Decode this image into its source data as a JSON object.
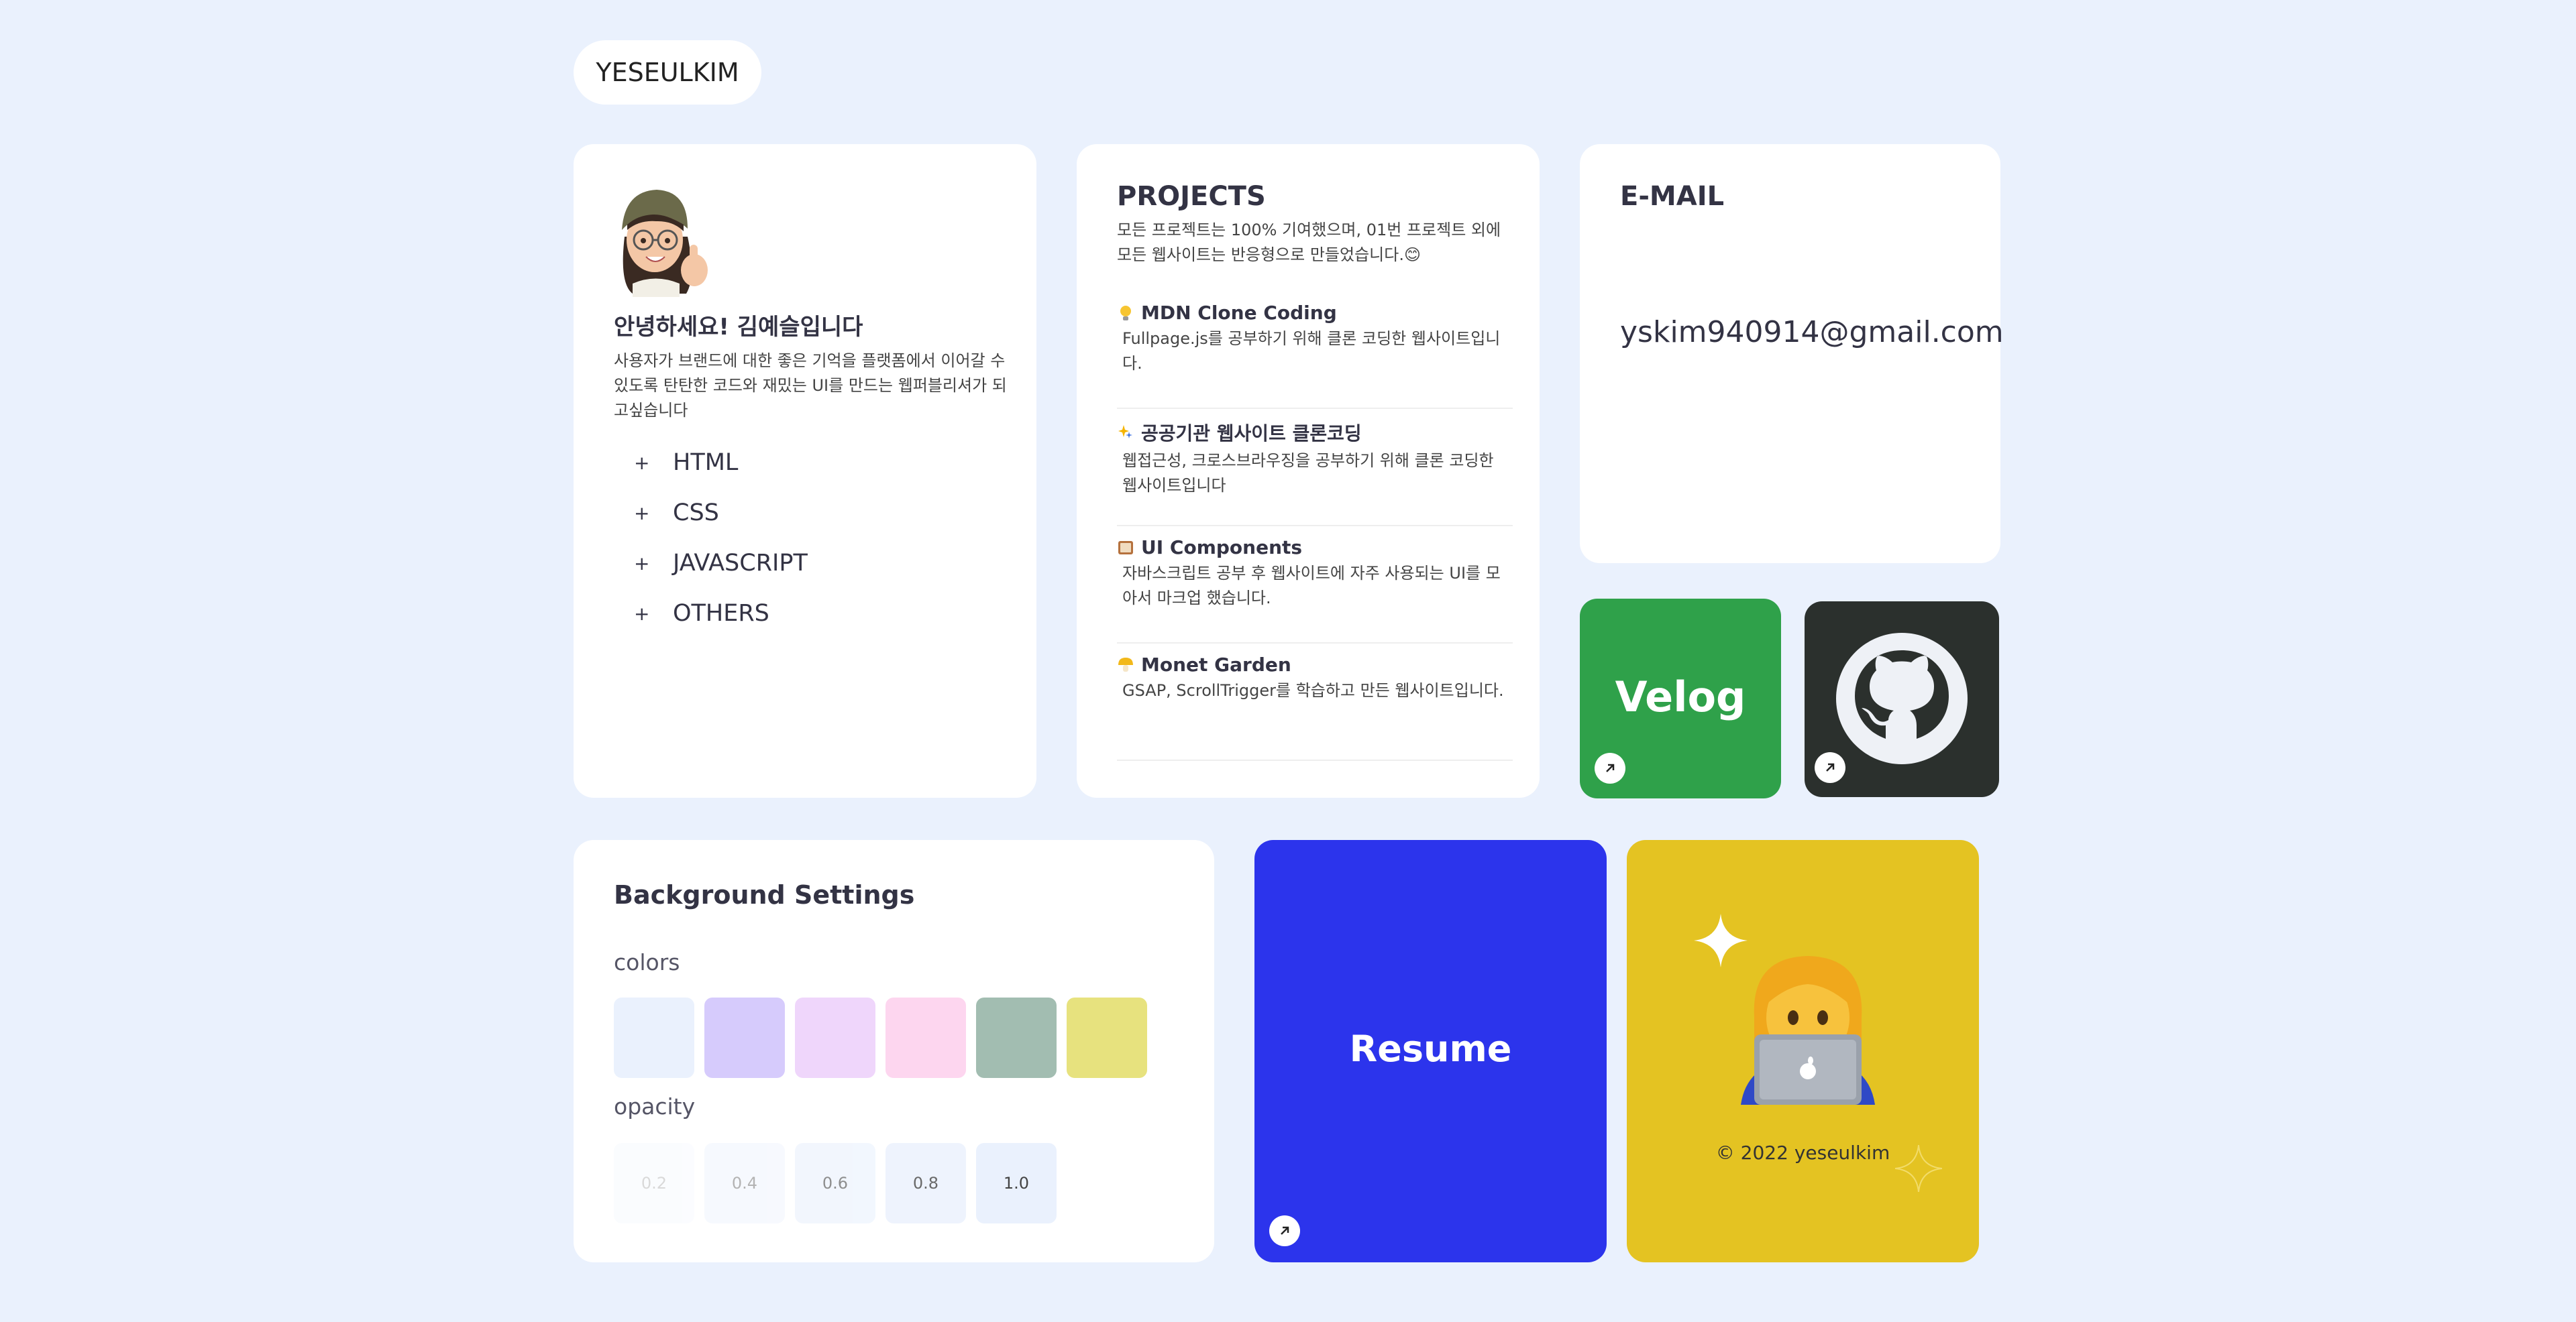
{
  "logo": "YESEULKIM",
  "about": {
    "avatar_icon": "memoji-thumbs-up-icon",
    "greeting": "안녕하세요! 김예슬입니다",
    "description": "사용자가 브랜드에 대한 좋은 기억을 플랫폼에서 이어갈 수 있도록 탄탄한 코드와 재밌는 UI를 만드는 웹퍼블리셔가 되고싶습니다",
    "skills": [
      {
        "label": "HTML"
      },
      {
        "label": "CSS"
      },
      {
        "label": "JAVASCRIPT"
      },
      {
        "label": "OTHERS"
      }
    ],
    "plus": "+"
  },
  "projects": {
    "title": "PROJECTS",
    "intro": "모든 프로젝트는 100% 기여했으며, 01번 프로젝트 외에 모든 웹사이트는 반응형으로 만들었습니다.😊",
    "items": [
      {
        "title": "MDN Clone Coding",
        "desc": "Fullpage.js를 공부하기 위해 클론 코딩한 웹사이트입니다.",
        "icon": "lightbulb-icon"
      },
      {
        "title": "공공기관 웹사이트 클론코딩",
        "desc": "웹접근성, 크로스브라우징을 공부하기 위해 클론 코딩한 웹사이트입니다",
        "icon": "sparkle-icon"
      },
      {
        "title": "UI Components",
        "desc": "자바스크립트 공부 후 웹사이트에 자주 사용되는 UI를 모아서 마크업 했습니다.",
        "icon": "book-icon"
      },
      {
        "title": "Monet Garden",
        "desc": "GSAP, ScrollTrigger를 학습하고 만든 웹사이트입니다.",
        "icon": "mushroom-icon"
      }
    ]
  },
  "email": {
    "title": "E-MAIL",
    "address": "yskim940914@gmail.com"
  },
  "velog": {
    "label": "Velog"
  },
  "github": {
    "icon": "github-octocat-icon"
  },
  "settings": {
    "title": "Background Settings",
    "colors_label": "colors",
    "opacity_label": "opacity",
    "colors": [
      "#eaf1fd",
      "#d6cbfc",
      "#efd6fb",
      "#fdd6ef",
      "#a2bdb1",
      "#e7e27e"
    ],
    "opacity": [
      "0.2",
      "0.4",
      "0.6",
      "0.8",
      "1.0"
    ]
  },
  "resume": {
    "label": "Resume"
  },
  "footer": {
    "copyright": "© 2022 yeseulkim"
  },
  "theme": {
    "accent_blue": "#2c34ec",
    "velog_green": "#2fa14a",
    "github_dark": "#2b302d",
    "footer_yellow": "#e4c322",
    "page_bg": "#eaf1fd"
  }
}
